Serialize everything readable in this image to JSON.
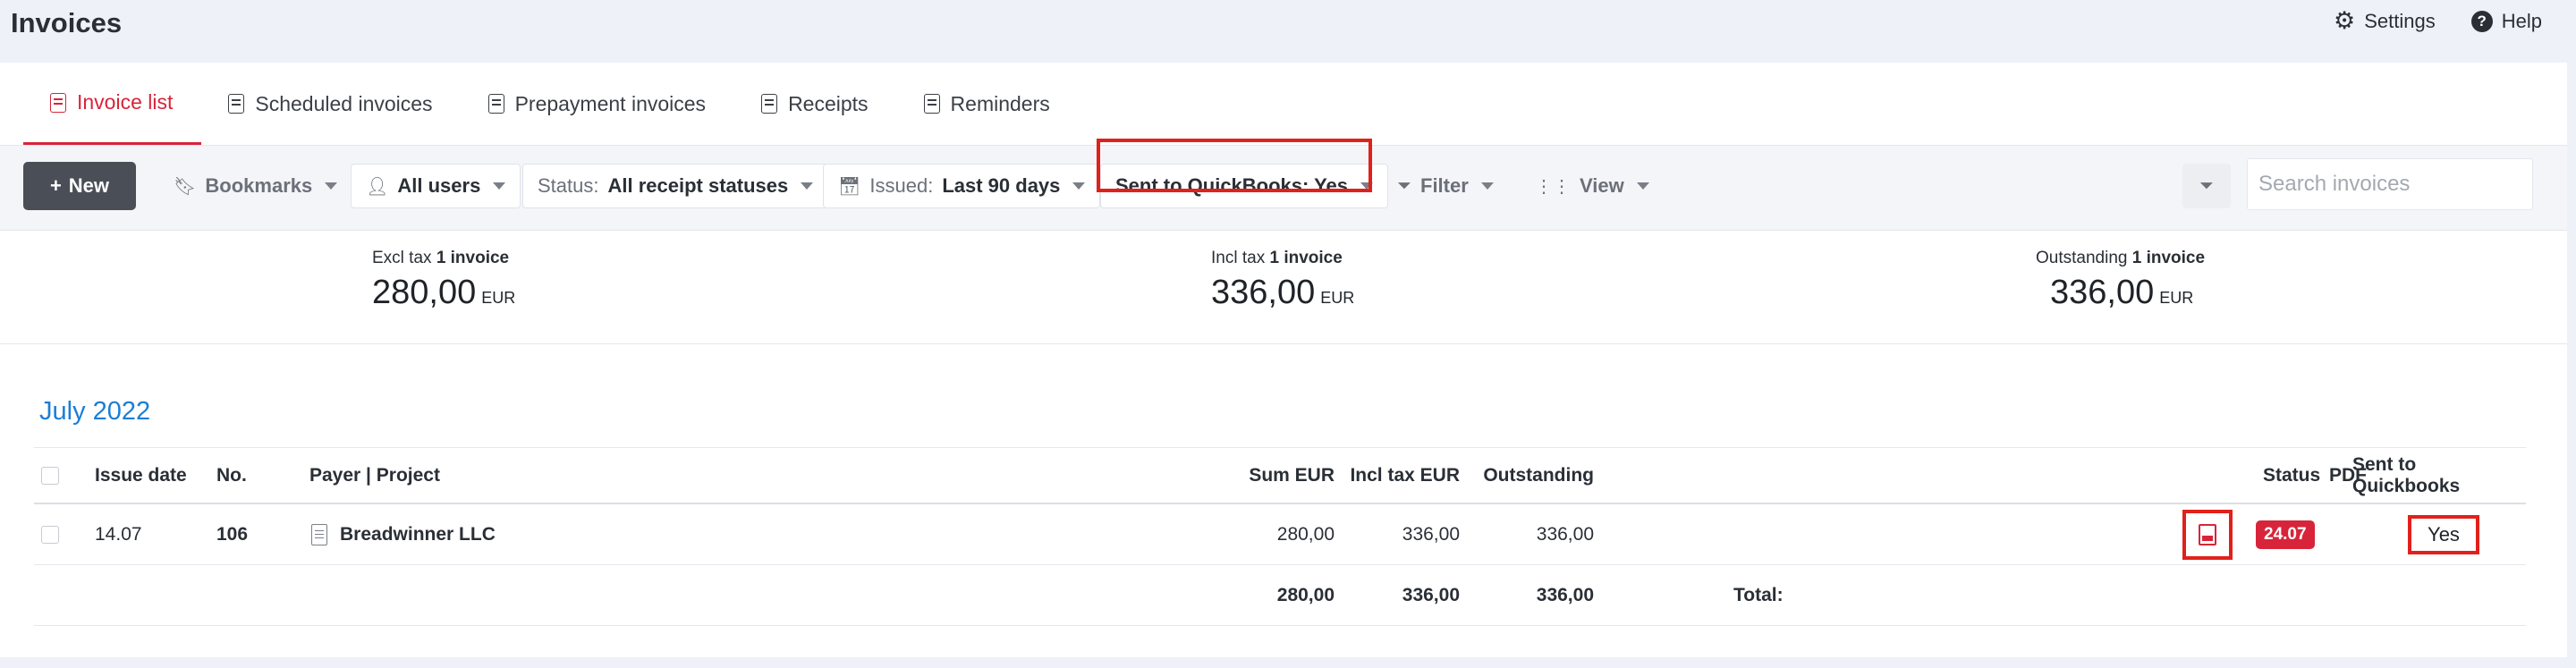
{
  "app": {
    "title": "Invoices",
    "settings_label": "Settings",
    "help_label": "Help"
  },
  "tabs": [
    {
      "label": "Invoice list",
      "active": true
    },
    {
      "label": "Scheduled invoices"
    },
    {
      "label": "Prepayment invoices"
    },
    {
      "label": "Receipts"
    },
    {
      "label": "Reminders"
    }
  ],
  "toolbar": {
    "new_label": "New",
    "bookmarks_label": "Bookmarks",
    "users_label": "All users",
    "status_prefix": "Status:",
    "status_value": "All receipt statuses",
    "issued_prefix": "Issued:",
    "issued_value": "Last 90 days",
    "quickbooks_label": "Sent to QuickBooks: Yes",
    "filter_label": "Filter",
    "view_label": "View",
    "search_placeholder": "Search invoices"
  },
  "summary": [
    {
      "label": "Excl tax",
      "count": "1 invoice",
      "value": "280,00",
      "currency": "EUR"
    },
    {
      "label": "Incl tax",
      "count": "1 invoice",
      "value": "336,00",
      "currency": "EUR"
    },
    {
      "label": "Outstanding",
      "count": "1 invoice",
      "value": "336,00",
      "currency": "EUR"
    }
  ],
  "table": {
    "group_label": "July 2022",
    "columns": {
      "issue_date": "Issue date",
      "no": "No.",
      "payer": "Payer | Project",
      "sum": "Sum EUR",
      "incl_tax": "Incl tax EUR",
      "outstanding": "Outstanding",
      "pdf": "PDF",
      "status": "Status",
      "quickbooks": "Sent to Quickbooks"
    },
    "rows": [
      {
        "issue_date": "14.07",
        "no": "106",
        "payer": "Breadwinner LLC",
        "sum": "280,00",
        "incl_tax": "336,00",
        "outstanding": "336,00",
        "status": "24.07",
        "quickbooks": "Yes"
      }
    ],
    "total": {
      "label": "Total:",
      "sum": "280,00",
      "incl_tax": "336,00",
      "outstanding": "336,00"
    }
  },
  "colors": {
    "accent": "#d8243a",
    "link": "#1b7ed6",
    "highlight": "#e0211b"
  }
}
